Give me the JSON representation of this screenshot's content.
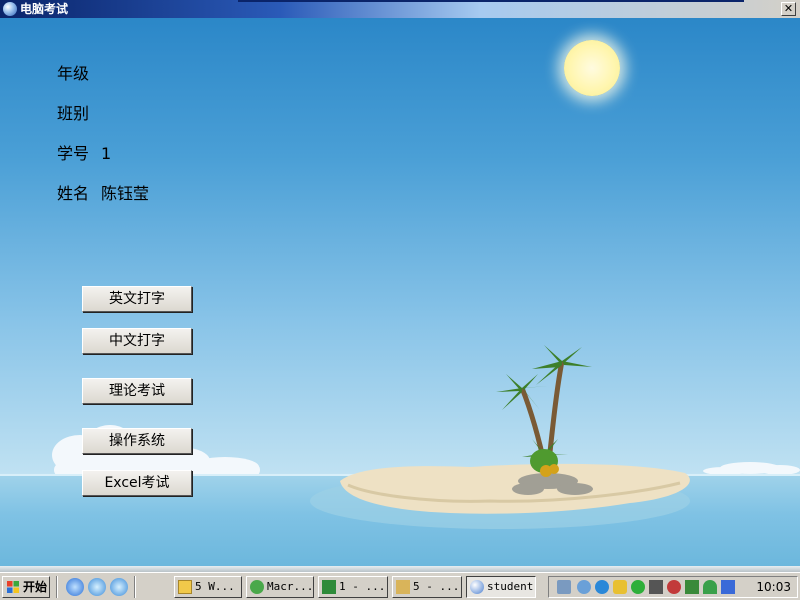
{
  "window": {
    "title": "电脑考试",
    "close_glyph": "✕"
  },
  "student_info": [
    {
      "label": "年级",
      "value": ""
    },
    {
      "label": "班别",
      "value": ""
    },
    {
      "label": "学号",
      "value": "1"
    },
    {
      "label": "姓名",
      "value": "陈钰莹"
    }
  ],
  "buttons": {
    "english_typing": "英文打字",
    "chinese_typing": "中文打字",
    "theory_exam": "理论考试",
    "operating_system": "操作系统",
    "excel_exam": "Excel考试"
  },
  "taskbar": {
    "start_label": "开始",
    "tasks": [
      {
        "label": "5 W...",
        "icon": "folder-icon"
      },
      {
        "label": "Macr...",
        "icon": "macromedia-icon"
      },
      {
        "label": "1 - ...",
        "icon": "eye-icon"
      },
      {
        "label": "5 - ...",
        "icon": "paint-icon"
      },
      {
        "label": "student",
        "icon": "globe-icon"
      }
    ],
    "clock": "10:03"
  },
  "colors": {
    "titlebar": "#0a246a",
    "sky": "#2b87c8",
    "sea": "#7fc2e4",
    "button_face": "#d4d0c8"
  }
}
